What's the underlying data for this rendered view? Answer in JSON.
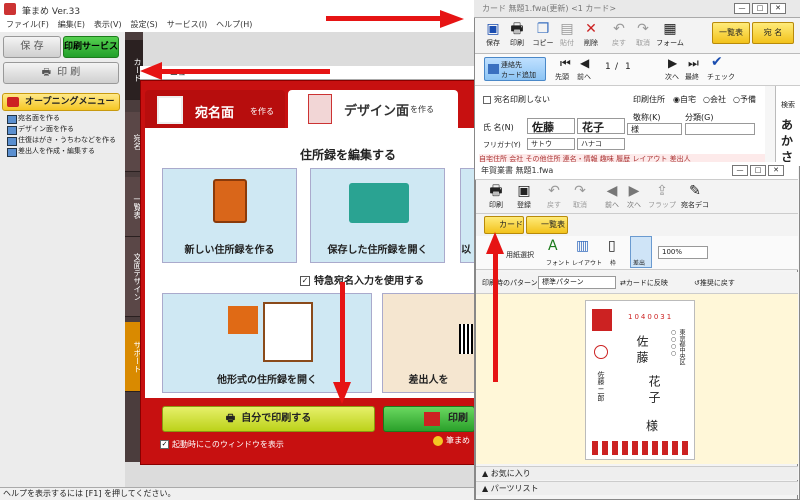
{
  "main_window": {
    "title": "筆まめ Ver.33",
    "menu": [
      "ファイル(F)",
      "編集(E)",
      "表示(V)",
      "設定(S)",
      "サービス(I)",
      "ヘルプ(H)"
    ],
    "save_label": "保 存",
    "print_service_label": "印刷サービス",
    "print_label": "印 刷",
    "opening_menu_title": "オープニングメニュー",
    "opening_menu_items": [
      "宛名面を作る",
      "デザイン面を作る",
      "住復はがき・うちわなどを作る",
      "差出人を作成・編集する"
    ],
    "side_tabs": [
      "カード",
      "宛名",
      "一覧表",
      "文面デザイン",
      "サポート"
    ],
    "status_text": "ヘルプを表示するには [F1] を押してください。"
  },
  "dialog": {
    "title_fragment": "ニュー",
    "tab_address": "宛名面",
    "tab_address_sub": "を作る",
    "tab_design": "デザイン面",
    "tab_design_sub": "を作る",
    "heading": "住所録を編集する",
    "card_new": "新しい住所録を作る",
    "card_open": "保存した住所録を開く",
    "card_third": "以",
    "special_checkbox": "特急宛名入力を使用する",
    "card_other_format": "他形式の住所録を開く",
    "card_sender": "差出人を",
    "self_print_button": "自分で印刷する",
    "print_service_button": "印刷",
    "startup_checkbox": "起動時にこのウィンドウを表示",
    "footer_link": "筆まめ"
  },
  "card_window": {
    "title": "カード  無題1.fwa(更新)  <1 カード>",
    "toolbar": [
      "保存",
      "印刷",
      "コピー",
      "貼付",
      "削除",
      "戻す",
      "取消",
      "フォーム"
    ],
    "btn_list": "一覧表",
    "btn_address": "宛 名",
    "add_card_label_1": "連絡先",
    "add_card_label_2": "カード追加",
    "nav_labels": [
      "先頭",
      "前へ",
      "次へ",
      "最終",
      "チェック"
    ],
    "page_current": "1",
    "page_sep": "/",
    "page_total": "1",
    "no_print_checkbox": "宛名印刷しない",
    "print_addr_label": "印刷住所",
    "print_addr_options": [
      "自宅",
      "会社",
      "予備"
    ],
    "name_label": "氏 名(N)",
    "last_name": "佐藤",
    "first_name": "花子",
    "furigana_label": "フリガナ(Y)",
    "furigana_last": "サトウ",
    "furigana_first": "ハナコ",
    "honorific_label": "敬称(K)",
    "honorific_value": "様",
    "category_label": "分類(G)",
    "search_label": "検索",
    "search_kana": [
      "あ",
      "か",
      "さ"
    ],
    "bottom_row": "自宅住所  会社  その他住所  連名・情報  趣味  履歴  レイアウト  差出人"
  },
  "nenga_window": {
    "title": "年賀業書  無題1.fwa",
    "toolbar": [
      "印刷",
      "登録",
      "戻す",
      "取消",
      "前へ",
      "次へ",
      "フラップ",
      "宛名デコ"
    ],
    "tab_card": "カード",
    "tab_list": "一覧表",
    "sub_labels": [
      "用紙選択",
      "フォント",
      "レイアウト",
      "枠",
      "差出"
    ],
    "zoom_value": "100%",
    "pattern_label": "印刷時のパターン",
    "pattern_value": "標準パターン",
    "reflect_label": "カードに反映",
    "recommend_label": "推奨に戻す",
    "postal_code": "1040031",
    "recipient_last": "佐 藤",
    "recipient_first": "花 子",
    "honorific": "様",
    "recipient_address": "東京都中央区 ○○○○",
    "sender_name": "佐藤 二郎",
    "favorites": "お気に入り",
    "parts_list": "パーツリスト"
  }
}
